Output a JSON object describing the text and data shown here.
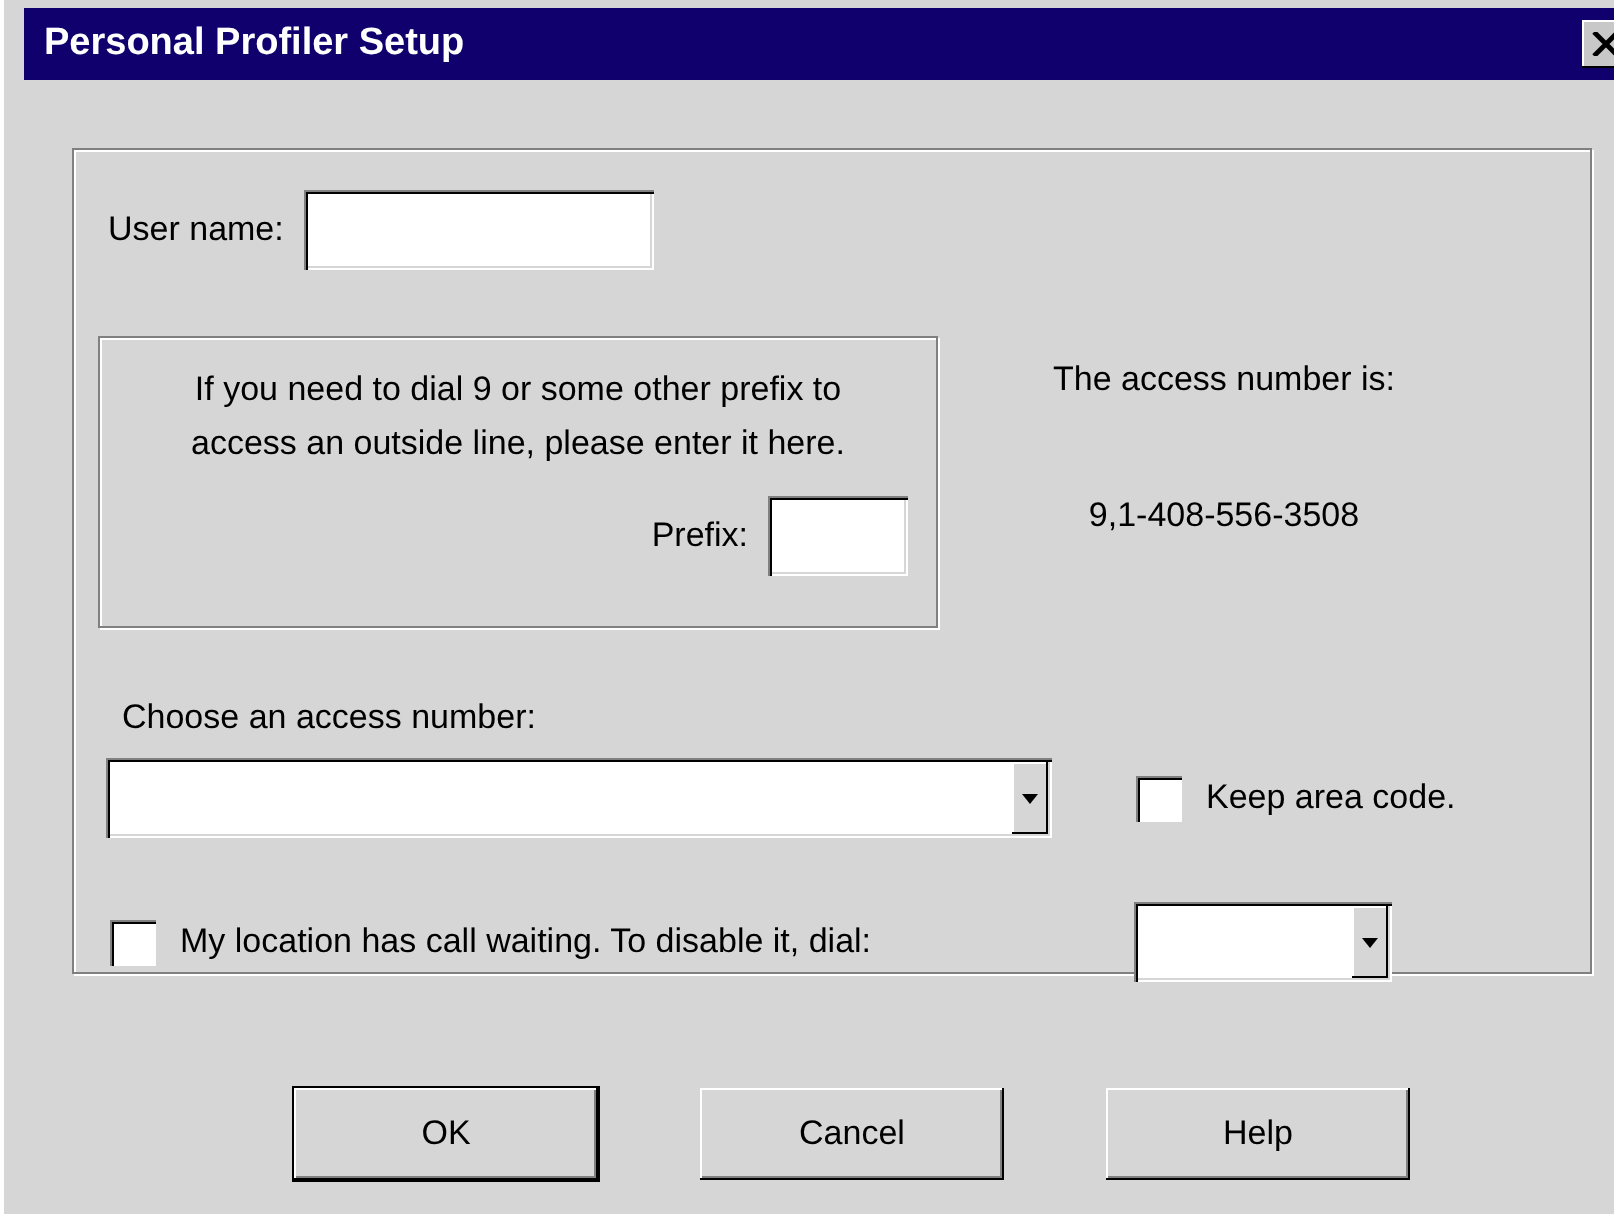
{
  "window": {
    "title": "Personal Profiler Setup"
  },
  "user_name": {
    "label": "User name:"
  },
  "prefix_box": {
    "instructions": [
      "If you need to dial 9 or some other prefix to",
      "access an outside line, please enter it here."
    ],
    "label": "Prefix:"
  },
  "access_number": {
    "caption": "The access number is:",
    "value": "9,1-408-556-3508"
  },
  "access_number_select": {
    "label": "Choose an access number:"
  },
  "keep_area_code": {
    "label": "Keep area code.",
    "checked": false
  },
  "call_waiting": {
    "label": "My location has call waiting. To disable it, dial:",
    "checked": false
  },
  "buttons": [
    {
      "label": "OK",
      "default": true
    },
    {
      "label": "Cancel",
      "default": false
    },
    {
      "label": "Help",
      "default": false
    }
  ]
}
